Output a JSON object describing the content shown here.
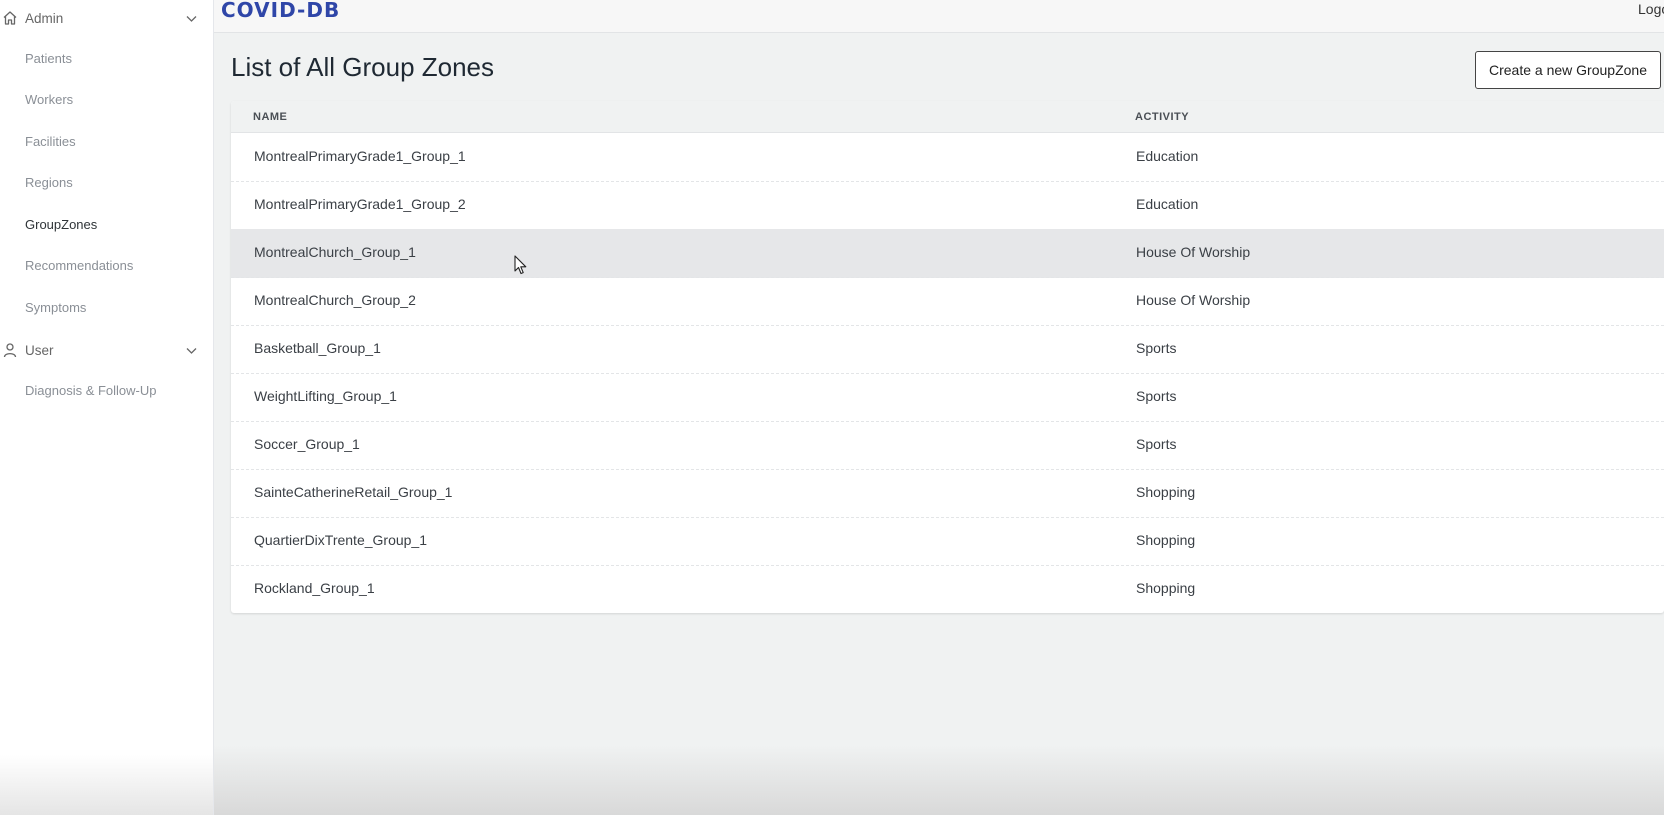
{
  "sidebar": {
    "admin_label": "Admin",
    "admin_icon": "home-icon",
    "admin_items": [
      "Patients",
      "Workers",
      "Facilities",
      "Regions",
      "GroupZones",
      "Recommendations",
      "Symptoms"
    ],
    "active_item": "GroupZones",
    "user_label": "User",
    "user_icon": "user-icon",
    "user_items": [
      "Diagnosis & Follow-Up"
    ]
  },
  "header": {
    "brand": "COVID-DB",
    "logout_label": "Logo",
    "brand_color": "#2f46a8"
  },
  "main": {
    "title": "List of All Group Zones",
    "create_button": "Create a new GroupZone",
    "table": {
      "columns": [
        "NAME",
        "ACTIVITY"
      ],
      "hover_row": 2,
      "rows": [
        {
          "name": "MontrealPrimaryGrade1_Group_1",
          "activity": "Education"
        },
        {
          "name": "MontrealPrimaryGrade1_Group_2",
          "activity": "Education"
        },
        {
          "name": "MontrealChurch_Group_1",
          "activity": "House Of Worship"
        },
        {
          "name": "MontrealChurch_Group_2",
          "activity": "House Of Worship"
        },
        {
          "name": "Basketball_Group_1",
          "activity": "Sports"
        },
        {
          "name": "WeightLifting_Group_1",
          "activity": "Sports"
        },
        {
          "name": "Soccer_Group_1",
          "activity": "Sports"
        },
        {
          "name": "SainteCatherineRetail_Group_1",
          "activity": "Shopping"
        },
        {
          "name": "QuartierDixTrente_Group_1",
          "activity": "Shopping"
        },
        {
          "name": "Rockland_Group_1",
          "activity": "Shopping"
        }
      ]
    }
  }
}
